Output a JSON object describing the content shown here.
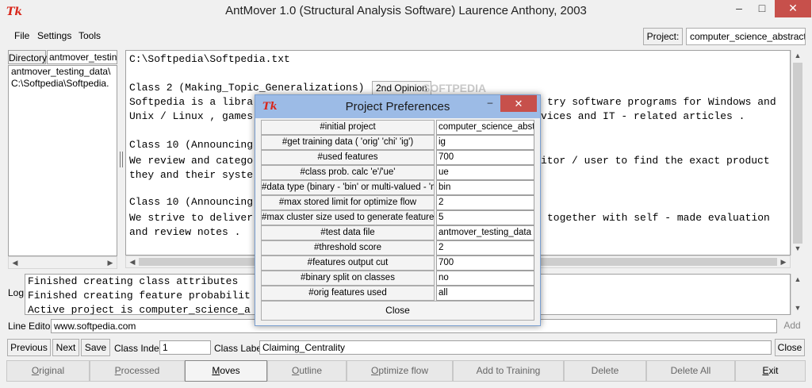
{
  "window": {
    "title": "AntMover 1.0 (Structural Analysis Software) Laurence Anthony, 2003",
    "icon": "tk-icon",
    "minimize": "–",
    "maximize": "□",
    "close": "✕"
  },
  "menu": {
    "file": "File",
    "settings": "Settings",
    "tools": "Tools"
  },
  "project": {
    "label": "Project:",
    "value": "computer_science_abstracts"
  },
  "directory": {
    "label": "Directory",
    "value": "antmover_testing_d",
    "items": [
      "antmover_testing_data\\",
      "C:\\Softpedia\\Softpedia."
    ]
  },
  "content": {
    "file_path": "C:\\Softpedia\\Softpedia.txt",
    "class2_heading": "Class 2 (Making_Topic_Generalizations)",
    "second_opinion": "2nd Opinion",
    "watermark": "SOFTPEDIA",
    "para1_line1_left": "Softpedia is a libra",
    "para1_line1_right": "try software programs for Windows and",
    "para1_line2_left": "Unix / Linux , games",
    "para1_line2_right": "vices and IT - related articles .",
    "class10_a": "Class 10 (Announcing",
    "para2_line1_left": "We review and catego",
    "para2_line1_right": "itor / user to find the exact product",
    "para2_line2_left": "they and their syste",
    "class10_b": "Class 10 (Announcing",
    "para3_line1_left": "We strive to deliver",
    "para3_line1_right": "together with self - made evaluation",
    "para3_line2": "and review notes ."
  },
  "log": {
    "label": "Log",
    "lines": [
      "Finished creating class attributes",
      "Finished creating feature probabilit",
      "Active project is computer_science_a"
    ]
  },
  "line_editor": {
    "label": "Line Editor",
    "value": "www.softpedia.com",
    "add": "Add"
  },
  "nav": {
    "previous": "Previous",
    "next": "Next",
    "save": "Save",
    "class_index_label": "Class Index",
    "class_index_value": "1",
    "class_label_label": "Class Label",
    "class_label_value": "Claiming_Centrality",
    "close": "Close"
  },
  "tabs": {
    "original": {
      "first": "O",
      "rest": "riginal"
    },
    "processed": {
      "first": "P",
      "rest": "rocessed"
    },
    "moves": {
      "first": "M",
      "rest": "oves"
    },
    "outline": {
      "first": "O",
      "rest": "utline"
    },
    "optimize": {
      "first": "O",
      "rest": "ptimize flow"
    },
    "add_training": "Add to Training",
    "delete": "Delete",
    "delete_all": "Delete All",
    "exit": {
      "first": "E",
      "rest": "xit"
    }
  },
  "dialog": {
    "title": "Project Preferences",
    "minimize": "–",
    "close": "✕",
    "rows": [
      {
        "key": "#initial project",
        "value": "computer_science_abstra"
      },
      {
        "key": "#get training data ( 'orig' 'chi' 'ig')",
        "value": "ig"
      },
      {
        "key": "#used features",
        "value": "700"
      },
      {
        "key": "#class prob. calc 'e'/'ue'",
        "value": "ue"
      },
      {
        "key": "#data type (binary - 'bin' or multi-valued - 'mv')",
        "value": "bin"
      },
      {
        "key": "#max stored limit for optimize flow",
        "value": "2"
      },
      {
        "key": "#max cluster size used to generate features",
        "value": "5"
      },
      {
        "key": "#test data file",
        "value": "antmover_testing_data"
      },
      {
        "key": "#threshold score",
        "value": "2"
      },
      {
        "key": "#features output cut",
        "value": "700"
      },
      {
        "key": "#binary split on classes",
        "value": "no"
      },
      {
        "key": "#orig features used",
        "value": "all"
      }
    ],
    "close_button": "Close"
  }
}
